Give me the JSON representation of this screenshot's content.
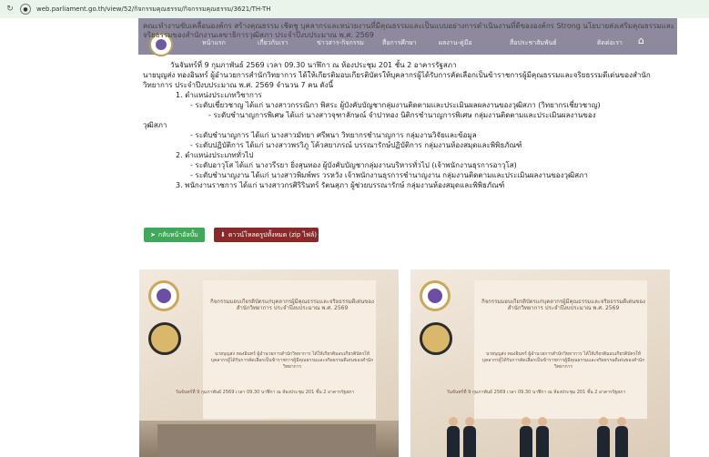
{
  "browser": {
    "url": "web.parliament.go.th/view/52/กิจกรรมคุณธรรม/กิจกรรมคุณธรรม/3621/TH-TH",
    "reload_icon": "reload-icon",
    "site_icon": "site-info-icon"
  },
  "nav": {
    "items": [
      "หน้าแรก",
      "เกี่ยวกับเรา",
      "ข่าวสาร-กิจกรรม",
      "สื่อการศึกษา",
      "ผลงาน-คู่มือ",
      "สื่อประชาสัมพันธ์",
      "ติดต่อเรา"
    ],
    "home_icon": "home-icon"
  },
  "intro_text": "คณะทำงานขับเคลื่อนองค์กร สร้างคุณธรรม เชิดชู บุคลากรและหน่วยงานที่มีคุณธรรมและเป็นแบบอย่างการดำเนินงานที่ดีขององค์กร Strong นโยบายส่งเสริมคุณธรรมและจริยธรรมของสำนักงานเลขาธิการวุฒิสภา ประจำปีงบประมาณ พ.ศ. 2569",
  "article": {
    "para1": "วันจันทร์ที่ 9 กุมภาพันธ์ 2569 เวลา 09.30 นาฬิกา ณ ห้องประชุม 201 ชั้น 2 อาคารรัฐสภา",
    "para2": "นายบุญส่ง ทองอินทร์ ผู้อำนวยการสำนักวิทยาการ ได้ให้เกียรติมอบเกียรติบัตรให้บุคลากรผู้ได้รับการคัดเลือกเป็นข้าราชการผู้มีคุณธรรมและจริยธรรมดีเด่นของสำนักวิทยาการ ประจำปีงบประมาณ พ.ศ. 2569 จำนวน 7 คน ดังนี้",
    "sec1": "1. ตำแหน่งประเภทวิชาการ",
    "sec1_a": "- ระดับเชี่ยวชาญ ได้แก่ นางสาวกรรณิกา พิสระ ผู้บังคับบัญชากลุ่มงานติดตามและประเมินผลผลงานของวุฒิสภา (วิทยากรเชี่ยวชาญ)",
    "sec1_b": "- ระดับชำนาญการพิเศษ ได้แก่ นางสาวจุฑาลักษณ์ จำปาทอง นิติกรชำนาญการพิเศษ กลุ่มงานติดตามและประเมินผลงานของ",
    "sec1_b_cont": "วุฒิสภา",
    "sec1_c": "- ระดับชำนาญการ ได้แก่ นางสาวมัทยา ศรีพนา วิทยากรชำนาญการ กลุ่มงานวิจัยและข้อมูล",
    "sec1_d": "- ระดับปฏิบัติการ ได้แก่ นางสาวพรวิภู โค้วสยาภรณ์ บรรณารักษ์ปฏิบัติการ กลุ่มงานห้องสมุดและพิพิธภัณฑ์",
    "sec2": "2. ตำแหน่งประเภททั่วไป",
    "sec2_a": "- ระดับอาวุโส ได้แก่ นางวรีรยา ยิ่งสุนทอง ผู้บังคับบัญชากลุ่มงานบริหารทั่วไป (เจ้าพนักงานธุรการอาวุโส)",
    "sec2_b": "- ระดับชำนาญงาน ได้แก่ นางสาวพิมพ์พร วรหวัง เจ้าพนักงานธุรการชำนาญงาน กลุ่มงานติดตามและประเมินผลงานของวุฒิสภา",
    "sec3": "3. พนักงานราชการ ได้แก่ นางสาวกรศิริรินทร์ รัตนสุภา ผู้ช่วยบรรณารักษ์ กลุ่มงานห้องสมุดและพิพิธภัณฑ์"
  },
  "buttons": {
    "back": "กลับหน้าอัลบั้ม",
    "back_icon": "back-arrow-icon",
    "download": "ดาวน์โหลดรูปทั้งหมด (zip ไฟล์)",
    "download_icon": "download-icon"
  },
  "photos": [
    {
      "banner_title": "กิจกรรมมอบเกียรติบัตรแก่บุคลากรผู้มีคุณธรรมและจริยธรรมดีเด่นของสำนักวิทยาการ ประจำปีงบประมาณ พ.ศ. 2569",
      "banner_sub": "นายบุญส่ง ทองอินทร์ ผู้อำนวยการสำนักวิทยาการ ได้ให้เกียรติมอบเกียรติบัตรให้บุคลากรผู้ได้รับการคัดเลือกเป็นข้าราชการผู้มีคุณธรรมและจริยธรรมดีเด่นของสำนักวิทยาการ",
      "banner_date": "วันจันทร์ที่ 9 กุมภาพันธ์ 2569 เวลา 09.30 นาฬิกา ณ ห้องประชุม 201 ชั้น 2 อาคารรัฐสภา"
    },
    {
      "banner_title": "กิจกรรมมอบเกียรติบัตรแก่บุคลากรผู้มีคุณธรรมและจริยธรรมดีเด่นของสำนักวิทยาการ ประจำปีงบประมาณ พ.ศ. 2569",
      "banner_sub": "นายบุญส่ง ทองอินทร์ ผู้อำนวยการสำนักวิทยาการ ได้ให้เกียรติมอบเกียรติบัตรให้บุคลากรผู้ได้รับการคัดเลือกเป็นข้าราชการผู้มีคุณธรรมและจริยธรรมดีเด่นของสำนักวิทยาการ",
      "banner_date": "วันจันทร์ที่ 9 กุมภาพันธ์ 2569 เวลา 09.30 นาฬิกา ณ ห้องประชุม 201 ชั้น 2 อาคารรัฐสภา"
    }
  ]
}
